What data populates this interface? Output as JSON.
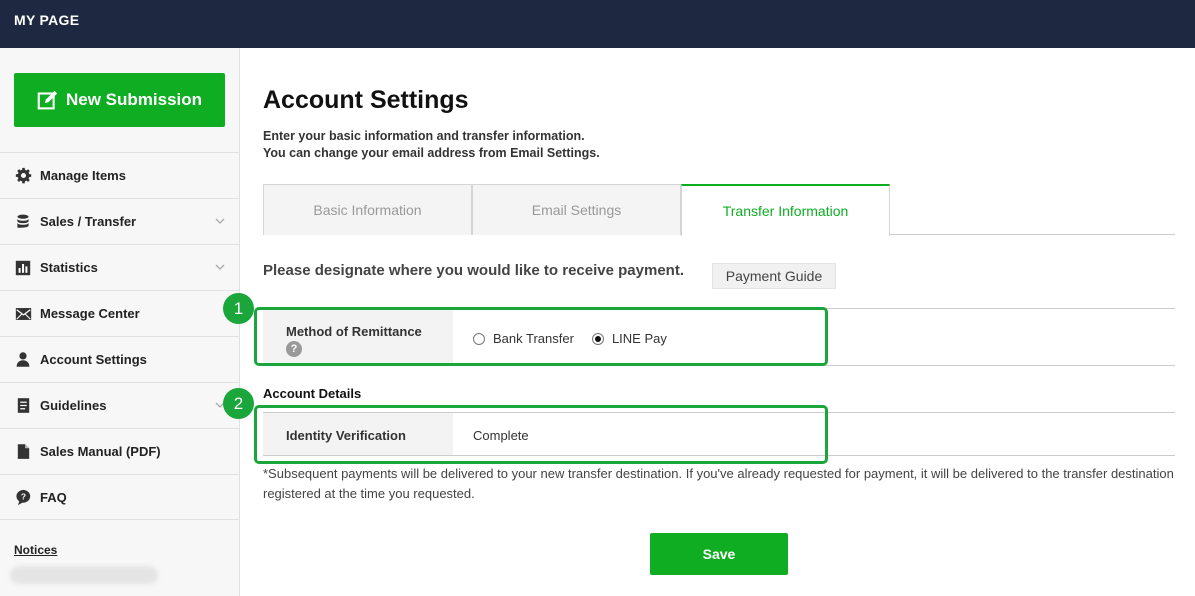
{
  "header": {
    "title": "MY PAGE"
  },
  "sidebar": {
    "new_submission": "New Submission",
    "items": [
      {
        "label": "Manage Items",
        "icon": "gear-icon"
      },
      {
        "label": "Sales / Transfer",
        "icon": "database-icon"
      },
      {
        "label": "Statistics",
        "icon": "bar-chart-icon"
      },
      {
        "label": "Message Center",
        "icon": "envelope-icon"
      },
      {
        "label": "Account Settings",
        "icon": "user-icon"
      },
      {
        "label": "Guidelines",
        "icon": "document-icon"
      },
      {
        "label": "Sales Manual (PDF)",
        "icon": "file-icon"
      },
      {
        "label": "FAQ",
        "icon": "question-bubble-icon"
      }
    ],
    "notices": "Notices"
  },
  "main": {
    "title": "Account Settings",
    "desc_line1": "Enter your basic information and transfer information.",
    "desc_line2": "You can change your email address from Email Settings.",
    "tabs": [
      {
        "label": "Basic Information"
      },
      {
        "label": "Email Settings"
      },
      {
        "label": "Transfer Information"
      }
    ],
    "designate": "Please designate where you would like to receive payment.",
    "payment_guide": "Payment Guide",
    "method_label": "Method of Remittance",
    "help_glyph": "?",
    "option_bank": "Bank Transfer",
    "option_line": "LINE Pay",
    "account_details": "Account Details",
    "identity_label": "Identity Verification",
    "identity_value": "Complete",
    "note": "*Subsequent payments will be delivered to your new transfer destination. If you've already requested for payment, it will be delivered to the transfer destination registered at the time you requested.",
    "save": "Save"
  },
  "annotations": {
    "badge1": "1",
    "badge2": "2"
  },
  "colors": {
    "header_bg": "#1e2840",
    "accent_green": "#0fae22",
    "highlight_green": "#1aa63a"
  }
}
